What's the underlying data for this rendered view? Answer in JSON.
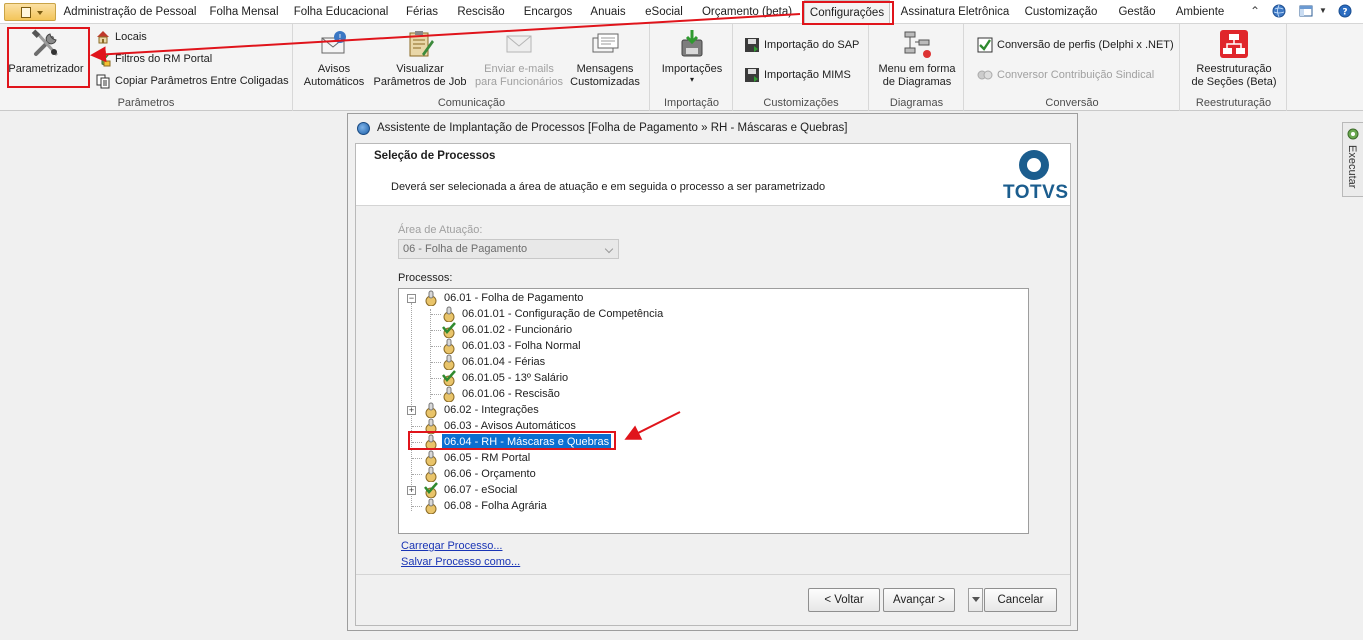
{
  "menubar": {
    "tabs": [
      "Administração de Pessoal",
      "Folha Mensal",
      "Folha Educacional",
      "Férias",
      "Rescisão",
      "Encargos",
      "Anuais",
      "eSocial",
      "Orçamento (beta)",
      "Configurações",
      "Assinatura Eletrônica",
      "Customização",
      "Gestão",
      "Ambiente"
    ],
    "active_tab": "Configurações",
    "right_icons": [
      "collapse-ribbon-icon",
      "globe-icon",
      "layout-icon",
      "help-icon"
    ]
  },
  "ribbon": {
    "parametros": {
      "title": "Parâmetros",
      "parametrizador": "Parametrizador",
      "locais": "Locais",
      "filtros": "Filtros do RM Portal",
      "copiar": "Copiar Parâmetros Entre Coligadas"
    },
    "comunicacao": {
      "title": "Comunicação",
      "avisos": [
        "Avisos",
        "Automáticos"
      ],
      "visualizar": [
        "Visualizar",
        "Parâmetros de Job"
      ],
      "enviar": [
        "Enviar e-mails",
        "para Funcionários"
      ],
      "mensagens": [
        "Mensagens",
        "Customizadas"
      ]
    },
    "importacao": {
      "title": "Importação",
      "importacoes": "Importações"
    },
    "customizacoes": {
      "title": "Customizações",
      "sap": "Importação do SAP",
      "mims": "Importação MIMS"
    },
    "diagramas": {
      "title": "Diagramas",
      "menu": [
        "Menu em forma",
        "de Diagramas"
      ]
    },
    "conversao": {
      "title": "Conversão",
      "perfis": "Conversão de perfis (Delphi x .NET)",
      "sindical": "Conversor Contribuição Sindical"
    },
    "reestruturacao": {
      "title": "Reestruturação",
      "reest": [
        "Reestruturação",
        "de Seções (Beta)"
      ]
    }
  },
  "side_panel": {
    "label": "Executar"
  },
  "dialog": {
    "title": "Assistente de Implantação de Processos [Folha de Pagamento » RH - Máscaras e Quebras]",
    "step_title": "Seleção de Processos",
    "step_desc": "Deverá ser selecionada a área de atuação e em seguida o processo a ser parametrizado",
    "logo": "TOTVS",
    "area_label": "Área de Atuação:",
    "area_value": "06 - Folha de Pagamento",
    "processes_label": "Processos:",
    "tree": [
      {
        "label": "06.01 - Folha de Pagamento",
        "checked": false
      },
      {
        "label": "06.01.01 - Configuração de Competência",
        "checked": false
      },
      {
        "label": "06.01.02 - Funcionário",
        "checked": true
      },
      {
        "label": "06.01.03 - Folha Normal",
        "checked": false
      },
      {
        "label": "06.01.04 - Férias",
        "checked": false
      },
      {
        "label": "06.01.05 - 13º Salário",
        "checked": true
      },
      {
        "label": "06.01.06 - Rescisão",
        "checked": false
      },
      {
        "label": "06.02 - Integrações",
        "checked": false
      },
      {
        "label": "06.03 - Avisos Automáticos",
        "checked": false
      },
      {
        "label": "06.04 - RH - Máscaras e Quebras",
        "checked": false,
        "selected": true
      },
      {
        "label": "06.05 - RM Portal",
        "checked": false
      },
      {
        "label": "06.06 - Orçamento",
        "checked": false
      },
      {
        "label": "06.07 - eSocial",
        "checked": true
      },
      {
        "label": "06.08 - Folha Agrária",
        "checked": false
      }
    ],
    "load_link": "Carregar Processo...",
    "save_link": "Salvar Processo como...",
    "back": "< Voltar",
    "next": "Avançar >",
    "cancel": "Cancelar"
  },
  "colors": {
    "annotation": "#e0141b",
    "selection": "#0a6fd1",
    "brand": "#1b5d8e"
  }
}
